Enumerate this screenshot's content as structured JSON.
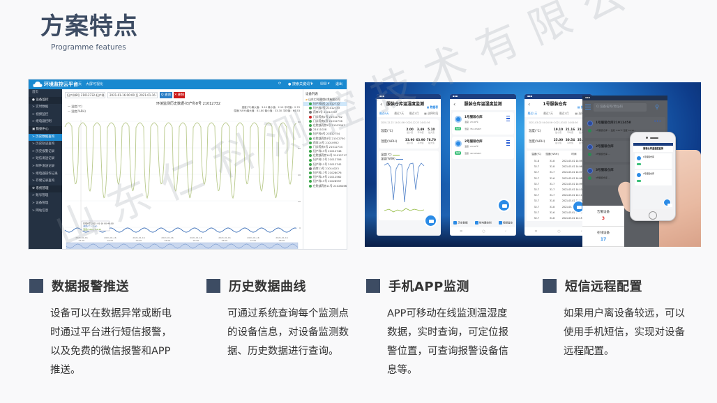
{
  "header": {
    "title": "方案特点",
    "subtitle": "Programme features"
  },
  "web_platform": {
    "brand": "环境监控云平台",
    "nav": [
      "首页",
      "大屏可视化"
    ],
    "top_right": [
      "⟳",
      "● 搜索关键词 ▾",
      "✎",
      "▤▤ ▾",
      "退出"
    ],
    "sidebar": [
      {
        "label": "首页",
        "type": "item"
      },
      {
        "label": "● 设备监控",
        "type": "group"
      },
      {
        "label": "> 实时数据",
        "type": "item"
      },
      {
        "label": "> 视频监控",
        "type": "item"
      },
      {
        "label": "> 继电器控制",
        "type": "item"
      },
      {
        "label": "▣ 数据中心",
        "type": "group"
      },
      {
        "label": "> 历史数据查询",
        "type": "active"
      },
      {
        "label": "> 历史轨迹查询",
        "type": "item"
      },
      {
        "label": "> 历史报警记录",
        "type": "item"
      },
      {
        "label": "> 短信发送记录",
        "type": "item"
      },
      {
        "label": "> 邮件发送记录",
        "type": "item"
      },
      {
        "label": "> 继电器操作记录",
        "type": "item"
      },
      {
        "label": "> 存储记录查询",
        "type": "item"
      },
      {
        "label": "⚙ 系统管理",
        "type": "group"
      },
      {
        "label": "> 账号管理",
        "type": "item"
      },
      {
        "label": "> 设备管理",
        "type": "item"
      },
      {
        "label": "> 网站信息",
        "type": "item"
      }
    ],
    "filter_device": "妇产科8号 21012732-妇产科8号",
    "filter_daterange": "2021-01-16 00:00 至 2021-01-16 11:16",
    "query_button": "Q 查询",
    "delete_button": "✕ 删除",
    "chart_title": "环境监测历史数据-妇产科8号 21012732",
    "legend_temp": "— 温度(℃)",
    "legend_hum": "— 湿度(%RH)",
    "stats_temp": "温度(℃)最大值：3.10 最小值：2.10 平均值：2.70",
    "stats_hum": "湿度(%RH)最大值：81.80 最小值：33.30 平均值：64.53",
    "tooltip": [
      "车载6号 2021-01-16 00:40:00",
      "温度(℃): 2.40",
      "湿度(%RH): 64.40"
    ],
    "x_ticks": [
      "2021-01-16\n01:00",
      "2021-01-16\n02:00",
      "2021-01-16\n03:00",
      "2021-01-16\n04:00",
      "2021-01-16\n05:00",
      "2021-01-16\n06:00",
      "2021-01-16\n07:00",
      "2021-01-16\n08:00"
    ],
    "y_ticks_right": [
      "80",
      "60",
      "40",
      "20",
      "0"
    ],
    "tree_title": "设备列表",
    "tree_root": "山东仁科测控技术有限公司",
    "tree_items": [
      {
        "label": "妇产科8号 21012732",
        "status": "online",
        "selected": true
      },
      {
        "label": "妇产科7号 21012733",
        "status": "online"
      },
      {
        "label": "药库5号 21012307",
        "status": "offline"
      },
      {
        "label": "门诊药房2号 21012762",
        "status": "alarm"
      },
      {
        "label": "门诊药房1号 21012736",
        "status": "online"
      },
      {
        "label": "住院部药房5号 21012097",
        "status": "online"
      },
      {
        "label": "21011028",
        "status": "offline"
      },
      {
        "label": "妇产科6号 21012754",
        "status": "online"
      },
      {
        "label": "住院部药房4号 21012750",
        "status": "online"
      },
      {
        "label": "药库10号 21010952",
        "status": "online"
      },
      {
        "label": "门诊药房3号 21012734",
        "status": "online"
      },
      {
        "label": "妇产科13号 21012748",
        "status": "online"
      },
      {
        "label": "住院部药房14号 21012717",
        "status": "online"
      },
      {
        "label": "妇产科12号 21012706",
        "status": "online"
      },
      {
        "label": "妇产科11号 21012742",
        "status": "online"
      },
      {
        "label": "药库11号 21014023",
        "status": "offline"
      },
      {
        "label": "妇产科17号 21028076",
        "status": "online"
      },
      {
        "label": "妇产科19号 21012562",
        "status": "online"
      },
      {
        "label": "妇产科13号 21028957",
        "status": "online"
      },
      {
        "label": "住院部药房11号 21028466",
        "status": "online"
      }
    ]
  },
  "app_screens": {
    "phone1": {
      "title": "服装仓库温湿度监测",
      "badge": "▦ 数据表",
      "tabs": [
        "最近6天",
        "最近7天",
        "最近1月",
        "▦ 选择时段"
      ],
      "range": "2020-12-22 14:01:56~2020-12-23 14:01:56",
      "temp_label": "温度(℃)",
      "temp_values": [
        {
          "v": "2.00",
          "l": "最小值"
        },
        {
          "v": "3.49",
          "l": "平均值"
        },
        {
          "v": "5.10",
          "l": "最大值"
        }
      ],
      "hum_label": "湿度(%RH)",
      "hum_values": [
        {
          "v": "33.90",
          "l": "最小值"
        },
        {
          "v": "63.90",
          "l": "平均值"
        },
        {
          "v": "78.70",
          "l": "最大值"
        }
      ],
      "legend_temp": "温度(℃)",
      "legend_hum": "湿度(%RH)"
    },
    "phone2": {
      "title": "服装仓库温湿度监测",
      "devices": [
        {
          "name": "1号服装仓库",
          "temp": "温度: 23.90℃",
          "hum": "湿度: 35.10%RH",
          "tag": "在线"
        },
        {
          "name": "2号服装仓库",
          "temp": "温度: 23.60℃",
          "hum": "湿度: 40.50%RH",
          "tag": "在线"
        }
      ],
      "bottom_nav": [
        "历史数据",
        "继电器控制",
        "视频监控"
      ],
      "sys_nav": [
        "≡",
        "○",
        "‹"
      ]
    },
    "phone3": {
      "title": "1号服装仓库",
      "badge": "▦ 折线图",
      "tabs": [
        "最近1天",
        "最近7天",
        "最近1月",
        "▦ 选择时段"
      ],
      "range": "2021-03-02 04:04:56~2021-03-02 14:04:56",
      "temp_label": "温度(℃)",
      "temp_values": [
        {
          "v": "19.10",
          "l": "最小值"
        },
        {
          "v": "21.16",
          "l": "平均值"
        },
        {
          "v": "23.60",
          "l": "最大值"
        }
      ],
      "hum_label": "湿度(%RH)",
      "hum_values": [
        {
          "v": "25.00",
          "l": "最小值"
        },
        {
          "v": "30.54",
          "l": "平均值"
        },
        {
          "v": "35.60",
          "l": "最大值"
        }
      ],
      "table_headers": [
        "温度(℃)",
        "湿度(%RH)",
        "时间"
      ],
      "table_rows": [
        [
          "31.8",
          "31.8",
          "2021-03-02 14:05:00"
        ],
        [
          "32.7",
          "31.8",
          "2021-03-02 14:06:00"
        ],
        [
          "32.7",
          "31.7",
          "2021-03-02 14:07:00"
        ],
        [
          "32.7",
          "31.6",
          "2021-03-02 14:08:00"
        ],
        [
          "32.7",
          "31.7",
          "2021-03-02 14:09:00"
        ],
        [
          "32.7",
          "31.7",
          "2021-03-02 14:10:00"
        ],
        [
          "32.7",
          "31.7",
          "2021-03-02 14:11:00"
        ],
        [
          "32.7",
          "31.8",
          "2021-03-02 14:12:00"
        ],
        [
          "32.7",
          "31.8",
          "2021-03-02 14:13:00"
        ],
        [
          "32.7",
          "31.6",
          "2021-03-02 14:14:00"
        ],
        [
          "32.7",
          "31.8",
          "2021-03-02 14:15:00"
        ]
      ]
    },
    "phone4": {
      "search_placeholder": "Q 设备名称/地址码",
      "devices": [
        {
          "name": "1号服装仓库21012458",
          "sub": "1号服装仓库 ... 温度 3.60℃ 湿度 34.50..."
        },
        {
          "name": "2号服装仓库",
          "sub": "2号服装仓库 ..."
        },
        {
          "name": "3号服装仓库",
          "sub": "3号服装仓库 ..."
        }
      ],
      "alarm_label": "告警设备",
      "alarm_count": "3",
      "online_label": "在线设备",
      "online_count": "17"
    },
    "iphone": {
      "title": "服装仓库温湿度监测",
      "devices": [
        "1号服装仓库",
        "2号服装仓库"
      ]
    }
  },
  "features": [
    {
      "title": "数据报警推送",
      "body": "设备可以在数据异常或断电时通过平台进行短信报警，以及免费的微信报警和APP推送。"
    },
    {
      "title": "历史数据曲线",
      "body": "可通过系统查询每个监测点的设备信息，对设备监测数据、历史数据进行查询。"
    },
    {
      "title": "手机APP监测",
      "body": "APP可移动在线监测温湿度数据，实时查询，可定位报警位置，可查询报警设备信息等。"
    },
    {
      "title": "短信远程配置",
      "body": "如果用户离设备较远，可以使用手机短信，实现对设备远程配置。"
    }
  ],
  "watermark": "山东仁科测控技术有限公司",
  "colors": {
    "accent_dark": "#3d4c63",
    "platform_blue": "#1989d0",
    "sidebar_dark": "#243142",
    "app_blue": "#2b8be6",
    "alarm_red": "#e03131",
    "online_blue": "#2b8be6",
    "temp_line": "#b8c98a",
    "hum_line": "#3b6fb8"
  }
}
